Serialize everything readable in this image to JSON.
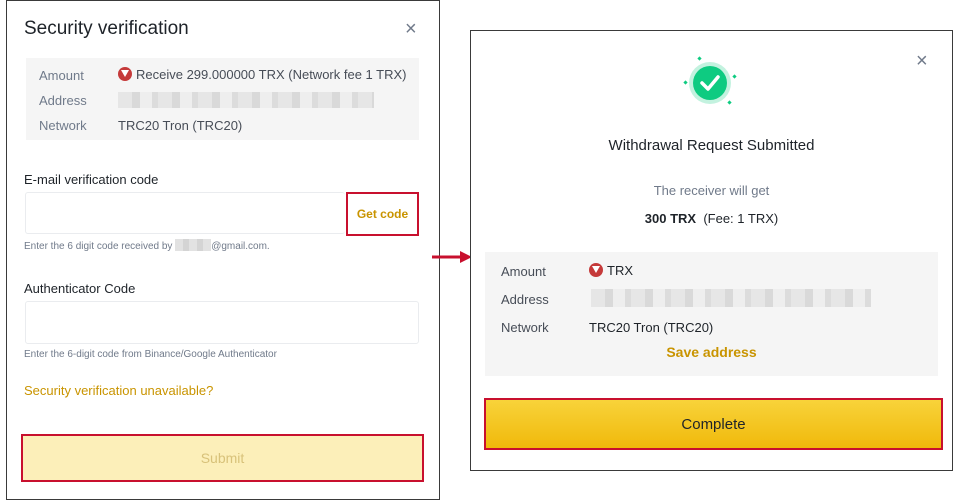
{
  "left_dialog": {
    "title": "Security verification",
    "close_symbol": "×",
    "summary": {
      "amount_label": "Amount",
      "amount_value": "Receive 299.000000 TRX (Network fee 1 TRX)",
      "address_label": "Address",
      "network_label": "Network",
      "network_value": "TRC20 Tron (TRC20)"
    },
    "email": {
      "label": "E-mail verification code",
      "value": "",
      "get_code_label": "Get code",
      "hint_prefix": "Enter the 6 digit code received by",
      "hint_suffix": "@gmail.com."
    },
    "authenticator": {
      "label": "Authenticator Code",
      "value": "",
      "hint": "Enter the 6-digit code from Binance/Google Authenticator"
    },
    "unavailable_link": "Security verification unavailable?",
    "submit_label": "Submit"
  },
  "right_dialog": {
    "close_symbol": "×",
    "title": "Withdrawal Request Submitted",
    "receiver_text": "The receiver will get",
    "amount_text": "300 TRX",
    "fee_text": "(Fee: 1 TRX)",
    "summary": {
      "amount_label": "Amount",
      "amount_value": "TRX",
      "address_label": "Address",
      "network_label": "Network",
      "network_value": "TRC20 Tron (TRC20)"
    },
    "save_address_label": "Save address",
    "complete_label": "Complete"
  },
  "colors": {
    "accent_gold": "#c99400",
    "button_gold": "#f0b90b",
    "success_green": "#0ecb81",
    "highlight_red": "#c8102e"
  },
  "icons": [
    "close-icon",
    "tron-icon",
    "success-check-icon",
    "arrow-right-icon"
  ]
}
